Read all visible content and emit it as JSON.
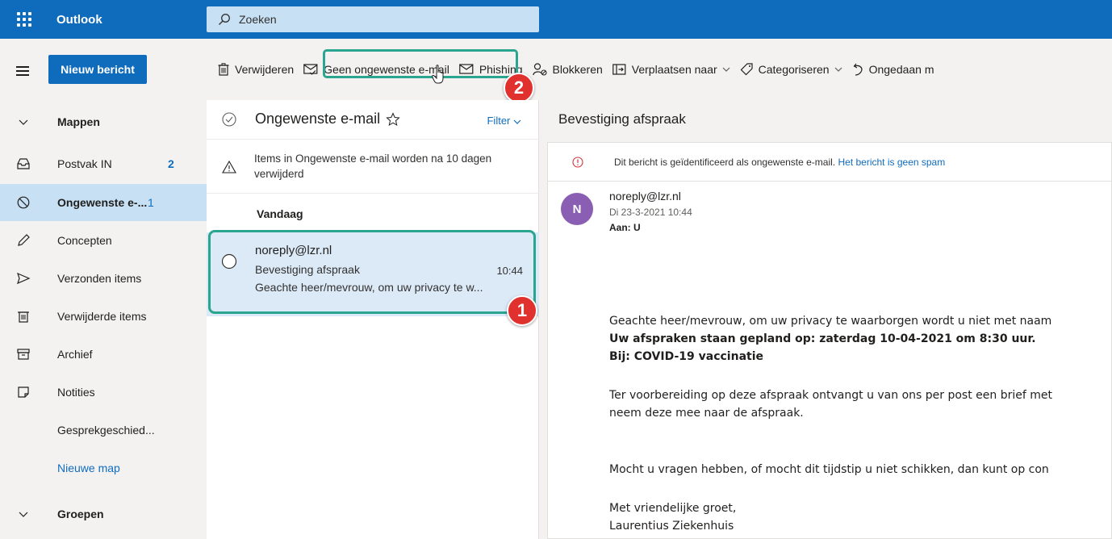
{
  "topbar": {
    "app_name": "Outlook",
    "search_placeholder": "Zoeken"
  },
  "command_bar": {
    "new_message": "Nieuw bericht",
    "delete": "Verwijderen",
    "not_junk": "Geen ongewenste e-mail",
    "phishing": "Phishing",
    "block": "Blokkeren",
    "move_to": "Verplaatsen naar",
    "categorize": "Categoriseren",
    "undo": "Ongedaan m"
  },
  "sidebar": {
    "folders_header": "Mappen",
    "items": [
      {
        "label": "Postvak IN",
        "count": "2",
        "icon": "inbox-icon"
      },
      {
        "label": "Ongewenste e-...",
        "count": "1",
        "icon": "blocked-icon"
      },
      {
        "label": "Concepten",
        "count": "",
        "icon": "pencil-icon"
      },
      {
        "label": "Verzonden items",
        "count": "",
        "icon": "send-icon"
      },
      {
        "label": "Verwijderde items",
        "count": "",
        "icon": "trash-icon"
      },
      {
        "label": "Archief",
        "count": "",
        "icon": "archive-icon"
      },
      {
        "label": "Notities",
        "count": "",
        "icon": "note-icon"
      },
      {
        "label": "Gesprekgeschied...",
        "count": "",
        "icon": ""
      },
      {
        "label": "Nieuwe map",
        "count": "",
        "icon": ""
      }
    ],
    "groups_header": "Groepen"
  },
  "message_list": {
    "title": "Ongewenste e-mail",
    "filter": "Filter",
    "notice": "Items in Ongewenste e-mail worden na 10 dagen verwijderd",
    "group": "Vandaag",
    "messages": [
      {
        "sender": "noreply@lzr.nl",
        "subject": "Bevestiging afspraak",
        "time": "10:44",
        "preview": "Geachte heer/mevrouw, om uw privacy te w..."
      }
    ]
  },
  "reading_pane": {
    "title": "Bevestiging afspraak",
    "spam_notice": "Dit bericht is geïdentificeerd als ongewenste e-mail.",
    "not_spam_link": "Het bericht is geen spam",
    "avatar_initial": "N",
    "from": "noreply@lzr.nl",
    "date": "Di 23-3-2021 10:44",
    "to": "Aan: U",
    "body": {
      "line1": "Geachte heer/mevrouw, om uw privacy te waarborgen wordt u niet met naam",
      "line2": "Uw afspraken staan gepland op: zaterdag 10-04-2021 om 8:30 uur.",
      "line3": "Bij: COVID-19 vaccinatie",
      "line4": "Ter voorbereiding op deze afspraak ontvangt u van ons per post een brief met",
      "line5": "neem deze mee naar de afspraak.",
      "line6": "Mocht u vragen hebben, of mocht dit tijdstip u niet schikken, dan kunt op con",
      "line7": "Met vriendelijke groet,",
      "line8": "Laurentius Ziekenhuis"
    }
  },
  "annotations": {
    "step1": "1",
    "step2": "2"
  },
  "colors": {
    "brand": "#0f6cbd",
    "highlight": "#2aa58f",
    "badge": "#e0312f"
  }
}
